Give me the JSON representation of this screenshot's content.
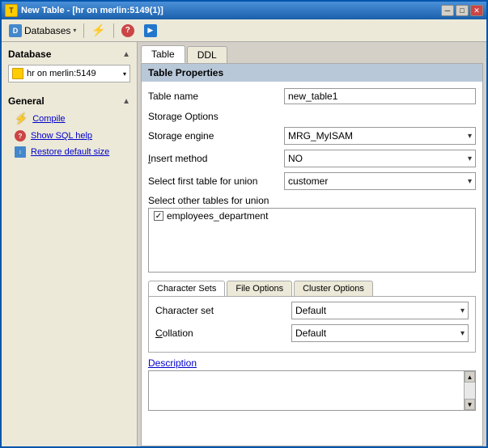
{
  "window": {
    "title": "New Table - [hr on merlin:5149(1)]",
    "min_btn": "─",
    "max_btn": "□",
    "close_btn": "✕"
  },
  "toolbar": {
    "databases_label": "Databases",
    "databases_arrow": "▾"
  },
  "sidebar": {
    "database_section": "Database",
    "db_name": "hr on merlin:5149",
    "general_section": "General",
    "items": [
      {
        "label": "Compile",
        "icon": "lightning"
      },
      {
        "label": "Show SQL help",
        "icon": "question"
      },
      {
        "label": "Restore default size",
        "icon": "resize"
      }
    ]
  },
  "tabs": [
    {
      "label": "Table",
      "active": true
    },
    {
      "label": "DDL",
      "active": false
    }
  ],
  "panel": {
    "header": "Table Properties",
    "table_name_label": "Table name",
    "table_name_value": "new_table1",
    "storage_options_label": "Storage Options",
    "storage_engine_label": "Storage engine",
    "storage_engine_value": "MRG_MyISAM",
    "insert_method_label": "Insert method",
    "insert_method_value": "NO",
    "first_table_label": "Select first table for union",
    "first_table_value": "customer",
    "other_tables_label": "Select other tables for union",
    "union_items": [
      {
        "checked": true,
        "label": "employees_department"
      }
    ]
  },
  "bottom_tabs": [
    {
      "label": "Character Sets",
      "active": true
    },
    {
      "label": "File Options",
      "active": false
    },
    {
      "label": "Cluster Options",
      "active": false
    }
  ],
  "bottom_panel": {
    "charset_label": "Character set",
    "charset_value": "Default",
    "collation_label": "Collation",
    "collation_value": "Default"
  },
  "description": {
    "label": "Description"
  }
}
